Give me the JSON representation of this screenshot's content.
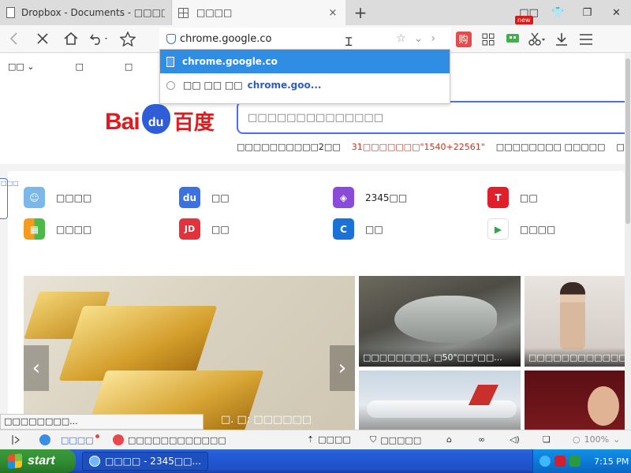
{
  "browser": {
    "tabs": [
      {
        "title": "Dropbox - Documents - □□□□",
        "close": "×"
      },
      {
        "title": "□□□□",
        "close": "×"
      }
    ],
    "new_tab": "+",
    "window_controls": [
      "□□",
      "👕",
      "❐",
      "✕"
    ],
    "address": "chrome.google.co",
    "toolbar_right": {
      "shop": "购",
      "new_badge": "new"
    }
  },
  "bookmarks": [
    {
      "label": "□□ ⌄"
    },
    {
      "label": "□"
    },
    {
      "label": "□"
    },
    {
      "label": "□"
    }
  ],
  "dropdown": {
    "items": [
      {
        "text": "chrome.google.co"
      },
      {
        "prefix": "□□ □□ □□",
        "text": "chrome.goo..."
      }
    ]
  },
  "baidu": {
    "logo_bai": "Bai",
    "logo_du": "du",
    "logo_cn": "百度",
    "search_placeholder": "□□□□□□□□□□□□□□",
    "hotwords": [
      {
        "text": "□□□□□□□□□□2□□",
        "red": false
      },
      {
        "text": "31□□□□□□□\"1540+22561\"",
        "red": true
      },
      {
        "text": "□□□□□□□□ □□□□□",
        "red": false
      },
      {
        "text": "□□□□□",
        "red": false
      }
    ]
  },
  "quick_links": [
    {
      "label": "□□□□",
      "icon": "qq-icon",
      "color": "#7bb7e8",
      "glyph": "☺"
    },
    {
      "label": "□□",
      "icon": "baidu-paw-icon",
      "color": "#3a73e0",
      "glyph": "du"
    },
    {
      "label": "2345□□",
      "icon": "gamepad-icon",
      "color": "#8a4cd8",
      "glyph": "◈"
    },
    {
      "label": "□□",
      "icon": "tmall-icon",
      "color": "#e01f2b",
      "glyph": "T"
    },
    {
      "label": "□□□□",
      "icon": "windows-tile-icon",
      "color": "#f39a1f",
      "glyph": "▦"
    },
    {
      "label": "□□",
      "icon": "jd-icon",
      "color": "#e2333d",
      "glyph": "JD"
    },
    {
      "label": "□□",
      "icon": "ctrip-icon",
      "color": "#1a72d8",
      "glyph": "C"
    },
    {
      "label": "□□□□",
      "icon": "play-store-icon",
      "color": "#ffffff",
      "glyph": "▶"
    }
  ],
  "feed": {
    "side_tag": "□□□",
    "big_caption": "□. □: □□□□□□",
    "thumbs": [
      {
        "caption": "□□□□□□□□, □50\"□□\"□□..."
      },
      {
        "caption": "□□□□□□□□□□□□□□"
      },
      {
        "caption": ""
      },
      {
        "caption": ""
      }
    ]
  },
  "status_text": "□□□□□□□□...",
  "bottombar": {
    "news": "□□□□",
    "favorites": "□□□□□□□□□□□□",
    "accelerate": "□□□□",
    "protect": "□□□□□",
    "zoom": "100%",
    "zoom_arrow": "⌄"
  },
  "taskbar": {
    "start_label": "start",
    "task_label": "□□□□ - 2345□□...",
    "clock": "7:15 PM"
  }
}
